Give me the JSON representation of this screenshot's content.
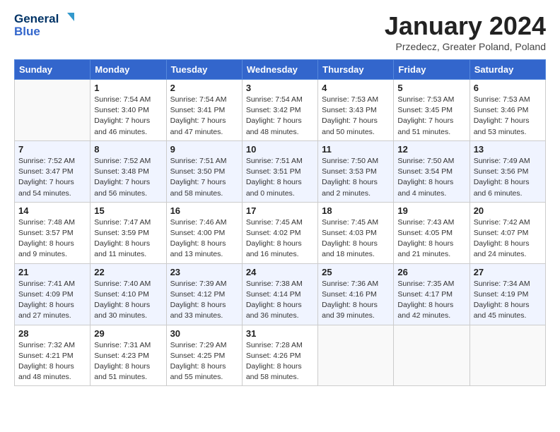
{
  "header": {
    "logo_line1": "General",
    "logo_line2": "Blue",
    "month_title": "January 2024",
    "subtitle": "Przedecz, Greater Poland, Poland"
  },
  "weekdays": [
    "Sunday",
    "Monday",
    "Tuesday",
    "Wednesday",
    "Thursday",
    "Friday",
    "Saturday"
  ],
  "weeks": [
    [
      {
        "day": "",
        "empty": true
      },
      {
        "day": "1",
        "sunrise": "7:54 AM",
        "sunset": "3:40 PM",
        "daylight": "7 hours and 46 minutes."
      },
      {
        "day": "2",
        "sunrise": "7:54 AM",
        "sunset": "3:41 PM",
        "daylight": "7 hours and 47 minutes."
      },
      {
        "day": "3",
        "sunrise": "7:54 AM",
        "sunset": "3:42 PM",
        "daylight": "7 hours and 48 minutes."
      },
      {
        "day": "4",
        "sunrise": "7:53 AM",
        "sunset": "3:43 PM",
        "daylight": "7 hours and 50 minutes."
      },
      {
        "day": "5",
        "sunrise": "7:53 AM",
        "sunset": "3:45 PM",
        "daylight": "7 hours and 51 minutes."
      },
      {
        "day": "6",
        "sunrise": "7:53 AM",
        "sunset": "3:46 PM",
        "daylight": "7 hours and 53 minutes."
      }
    ],
    [
      {
        "day": "7",
        "sunrise": "7:52 AM",
        "sunset": "3:47 PM",
        "daylight": "7 hours and 54 minutes."
      },
      {
        "day": "8",
        "sunrise": "7:52 AM",
        "sunset": "3:48 PM",
        "daylight": "7 hours and 56 minutes."
      },
      {
        "day": "9",
        "sunrise": "7:51 AM",
        "sunset": "3:50 PM",
        "daylight": "7 hours and 58 minutes."
      },
      {
        "day": "10",
        "sunrise": "7:51 AM",
        "sunset": "3:51 PM",
        "daylight": "8 hours and 0 minutes."
      },
      {
        "day": "11",
        "sunrise": "7:50 AM",
        "sunset": "3:53 PM",
        "daylight": "8 hours and 2 minutes."
      },
      {
        "day": "12",
        "sunrise": "7:50 AM",
        "sunset": "3:54 PM",
        "daylight": "8 hours and 4 minutes."
      },
      {
        "day": "13",
        "sunrise": "7:49 AM",
        "sunset": "3:56 PM",
        "daylight": "8 hours and 6 minutes."
      }
    ],
    [
      {
        "day": "14",
        "sunrise": "7:48 AM",
        "sunset": "3:57 PM",
        "daylight": "8 hours and 9 minutes."
      },
      {
        "day": "15",
        "sunrise": "7:47 AM",
        "sunset": "3:59 PM",
        "daylight": "8 hours and 11 minutes."
      },
      {
        "day": "16",
        "sunrise": "7:46 AM",
        "sunset": "4:00 PM",
        "daylight": "8 hours and 13 minutes."
      },
      {
        "day": "17",
        "sunrise": "7:45 AM",
        "sunset": "4:02 PM",
        "daylight": "8 hours and 16 minutes."
      },
      {
        "day": "18",
        "sunrise": "7:45 AM",
        "sunset": "4:03 PM",
        "daylight": "8 hours and 18 minutes."
      },
      {
        "day": "19",
        "sunrise": "7:43 AM",
        "sunset": "4:05 PM",
        "daylight": "8 hours and 21 minutes."
      },
      {
        "day": "20",
        "sunrise": "7:42 AM",
        "sunset": "4:07 PM",
        "daylight": "8 hours and 24 minutes."
      }
    ],
    [
      {
        "day": "21",
        "sunrise": "7:41 AM",
        "sunset": "4:09 PM",
        "daylight": "8 hours and 27 minutes."
      },
      {
        "day": "22",
        "sunrise": "7:40 AM",
        "sunset": "4:10 PM",
        "daylight": "8 hours and 30 minutes."
      },
      {
        "day": "23",
        "sunrise": "7:39 AM",
        "sunset": "4:12 PM",
        "daylight": "8 hours and 33 minutes."
      },
      {
        "day": "24",
        "sunrise": "7:38 AM",
        "sunset": "4:14 PM",
        "daylight": "8 hours and 36 minutes."
      },
      {
        "day": "25",
        "sunrise": "7:36 AM",
        "sunset": "4:16 PM",
        "daylight": "8 hours and 39 minutes."
      },
      {
        "day": "26",
        "sunrise": "7:35 AM",
        "sunset": "4:17 PM",
        "daylight": "8 hours and 42 minutes."
      },
      {
        "day": "27",
        "sunrise": "7:34 AM",
        "sunset": "4:19 PM",
        "daylight": "8 hours and 45 minutes."
      }
    ],
    [
      {
        "day": "28",
        "sunrise": "7:32 AM",
        "sunset": "4:21 PM",
        "daylight": "8 hours and 48 minutes."
      },
      {
        "day": "29",
        "sunrise": "7:31 AM",
        "sunset": "4:23 PM",
        "daylight": "8 hours and 51 minutes."
      },
      {
        "day": "30",
        "sunrise": "7:29 AM",
        "sunset": "4:25 PM",
        "daylight": "8 hours and 55 minutes."
      },
      {
        "day": "31",
        "sunrise": "7:28 AM",
        "sunset": "4:26 PM",
        "daylight": "8 hours and 58 minutes."
      },
      {
        "day": "",
        "empty": true
      },
      {
        "day": "",
        "empty": true
      },
      {
        "day": "",
        "empty": true
      }
    ]
  ]
}
